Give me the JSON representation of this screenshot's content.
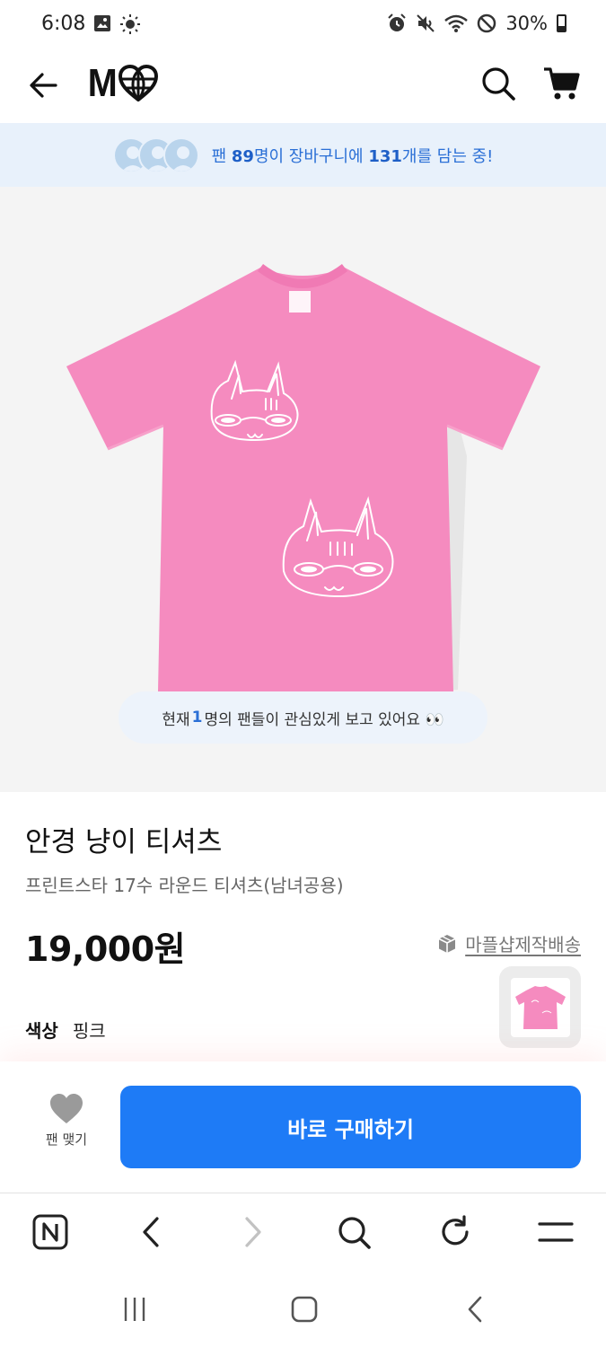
{
  "status_bar": {
    "time": "6:08",
    "battery": "30%",
    "icons": [
      "gallery-icon",
      "brightness-icon",
      "alarm-icon",
      "mute-icon",
      "wifi-icon",
      "do-not-disturb-icon",
      "battery-icon"
    ]
  },
  "header": {
    "logo_text": "M",
    "icons": [
      "back-arrow-icon",
      "heart-globe-logo-icon",
      "search-icon",
      "cart-icon"
    ]
  },
  "fan_banner": {
    "prefix": "팬 ",
    "fans": "89",
    "middle": "명이 장바구니에 ",
    "items": "131",
    "suffix": "개를 담는 중!"
  },
  "product": {
    "viewers_prefix": "현재 ",
    "viewers_count": "1",
    "viewers_suffix": "명의 팬들이 관심있게 보고 있어요 👀",
    "title": "안경 냥이 티셔츠",
    "subtitle": "프린트스타 17수 라운드 티셔츠(남녀공용)",
    "price": "19,000원",
    "shipping_label": "마플샵제작배송",
    "color_label": "색상",
    "color_value": "핑크",
    "shirt_color": "#f58bbf"
  },
  "purchase_bar": {
    "fan_label": "팬 맺기",
    "buy_label": "바로 구매하기",
    "buy_color": "#1e7bf6"
  },
  "browser_bar": {
    "buttons": [
      "naver-home-icon",
      "browser-back-icon",
      "browser-forward-icon",
      "browser-search-icon",
      "reload-icon",
      "menu-icon"
    ]
  },
  "system_nav": {
    "buttons": [
      "recent-apps-icon",
      "home-icon",
      "system-back-icon"
    ]
  }
}
